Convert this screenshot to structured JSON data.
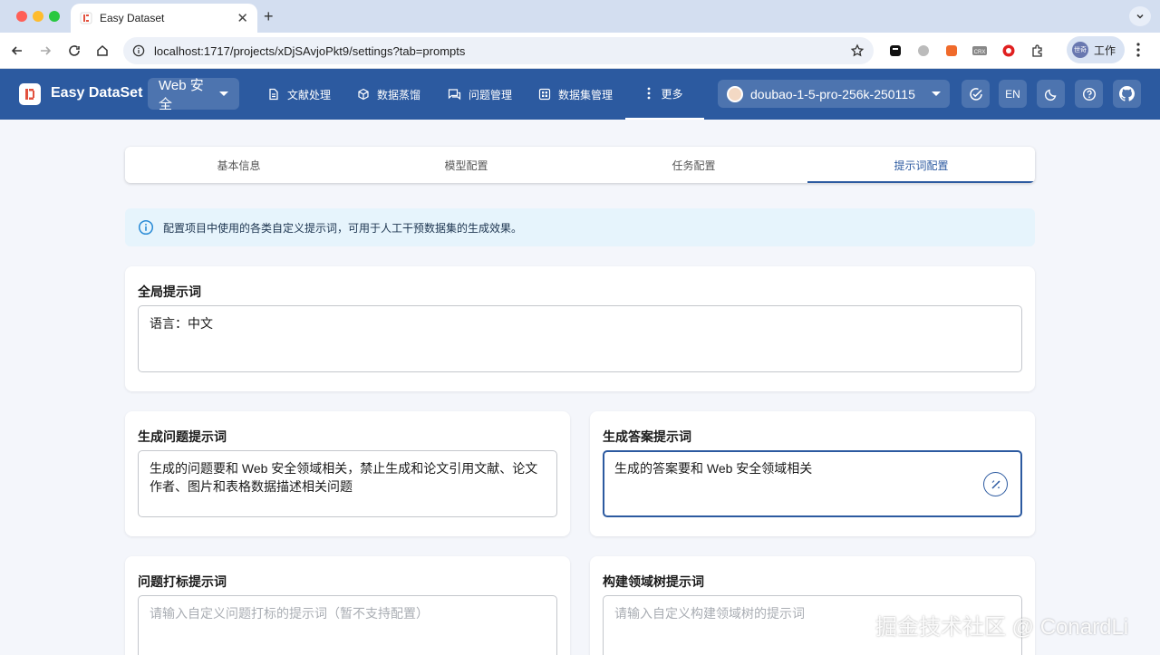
{
  "browser": {
    "tab_title": "Easy Dataset",
    "new_tab_label": "+",
    "url": "localhost:1717/projects/xDjSAvjoPkt9/settings?tab=prompts",
    "profile_name": "工作",
    "profile_avatar_text": "世奇"
  },
  "app": {
    "brand": "Easy DataSet",
    "project": "Web 安全",
    "menu": [
      {
        "label": "文献处理",
        "icon": "document-icon"
      },
      {
        "label": "数据蒸馏",
        "icon": "cube-icon"
      },
      {
        "label": "问题管理",
        "icon": "chat-icon"
      },
      {
        "label": "数据集管理",
        "icon": "grid-icon"
      }
    ],
    "more_label": "更多",
    "model": "doubao-1-5-pro-256k-250115",
    "lang_label": "EN"
  },
  "settings_tabs": [
    "基本信息",
    "模型配置",
    "任务配置",
    "提示词配置"
  ],
  "active_tab_index": 3,
  "info_text": "配置项目中使用的各类自定义提示词，可用于人工干预数据集的生成效果。",
  "prompts": {
    "global": {
      "title": "全局提示词",
      "value": "语言：中文"
    },
    "question": {
      "title": "生成问题提示词",
      "value": "生成的问题要和 Web 安全领域相关，禁止生成和论文引用文献、论文作者、图片和表格数据描述相关问题"
    },
    "answer": {
      "title": "生成答案提示词",
      "value": "生成的答案要和 Web 安全领域相关"
    },
    "label": {
      "title": "问题打标提示词",
      "placeholder": "请输入自定义问题打标的提示词（暂不支持配置）"
    },
    "domain_tree": {
      "title": "构建领域树提示词",
      "placeholder": "请输入自定义构建领域树的提示词"
    }
  },
  "watermark": "掘金技术社区 @ ConardLi",
  "colors": {
    "primary": "#2c5aa0",
    "info_bg": "#e6f4fc",
    "page_bg": "#f4f6fb"
  }
}
